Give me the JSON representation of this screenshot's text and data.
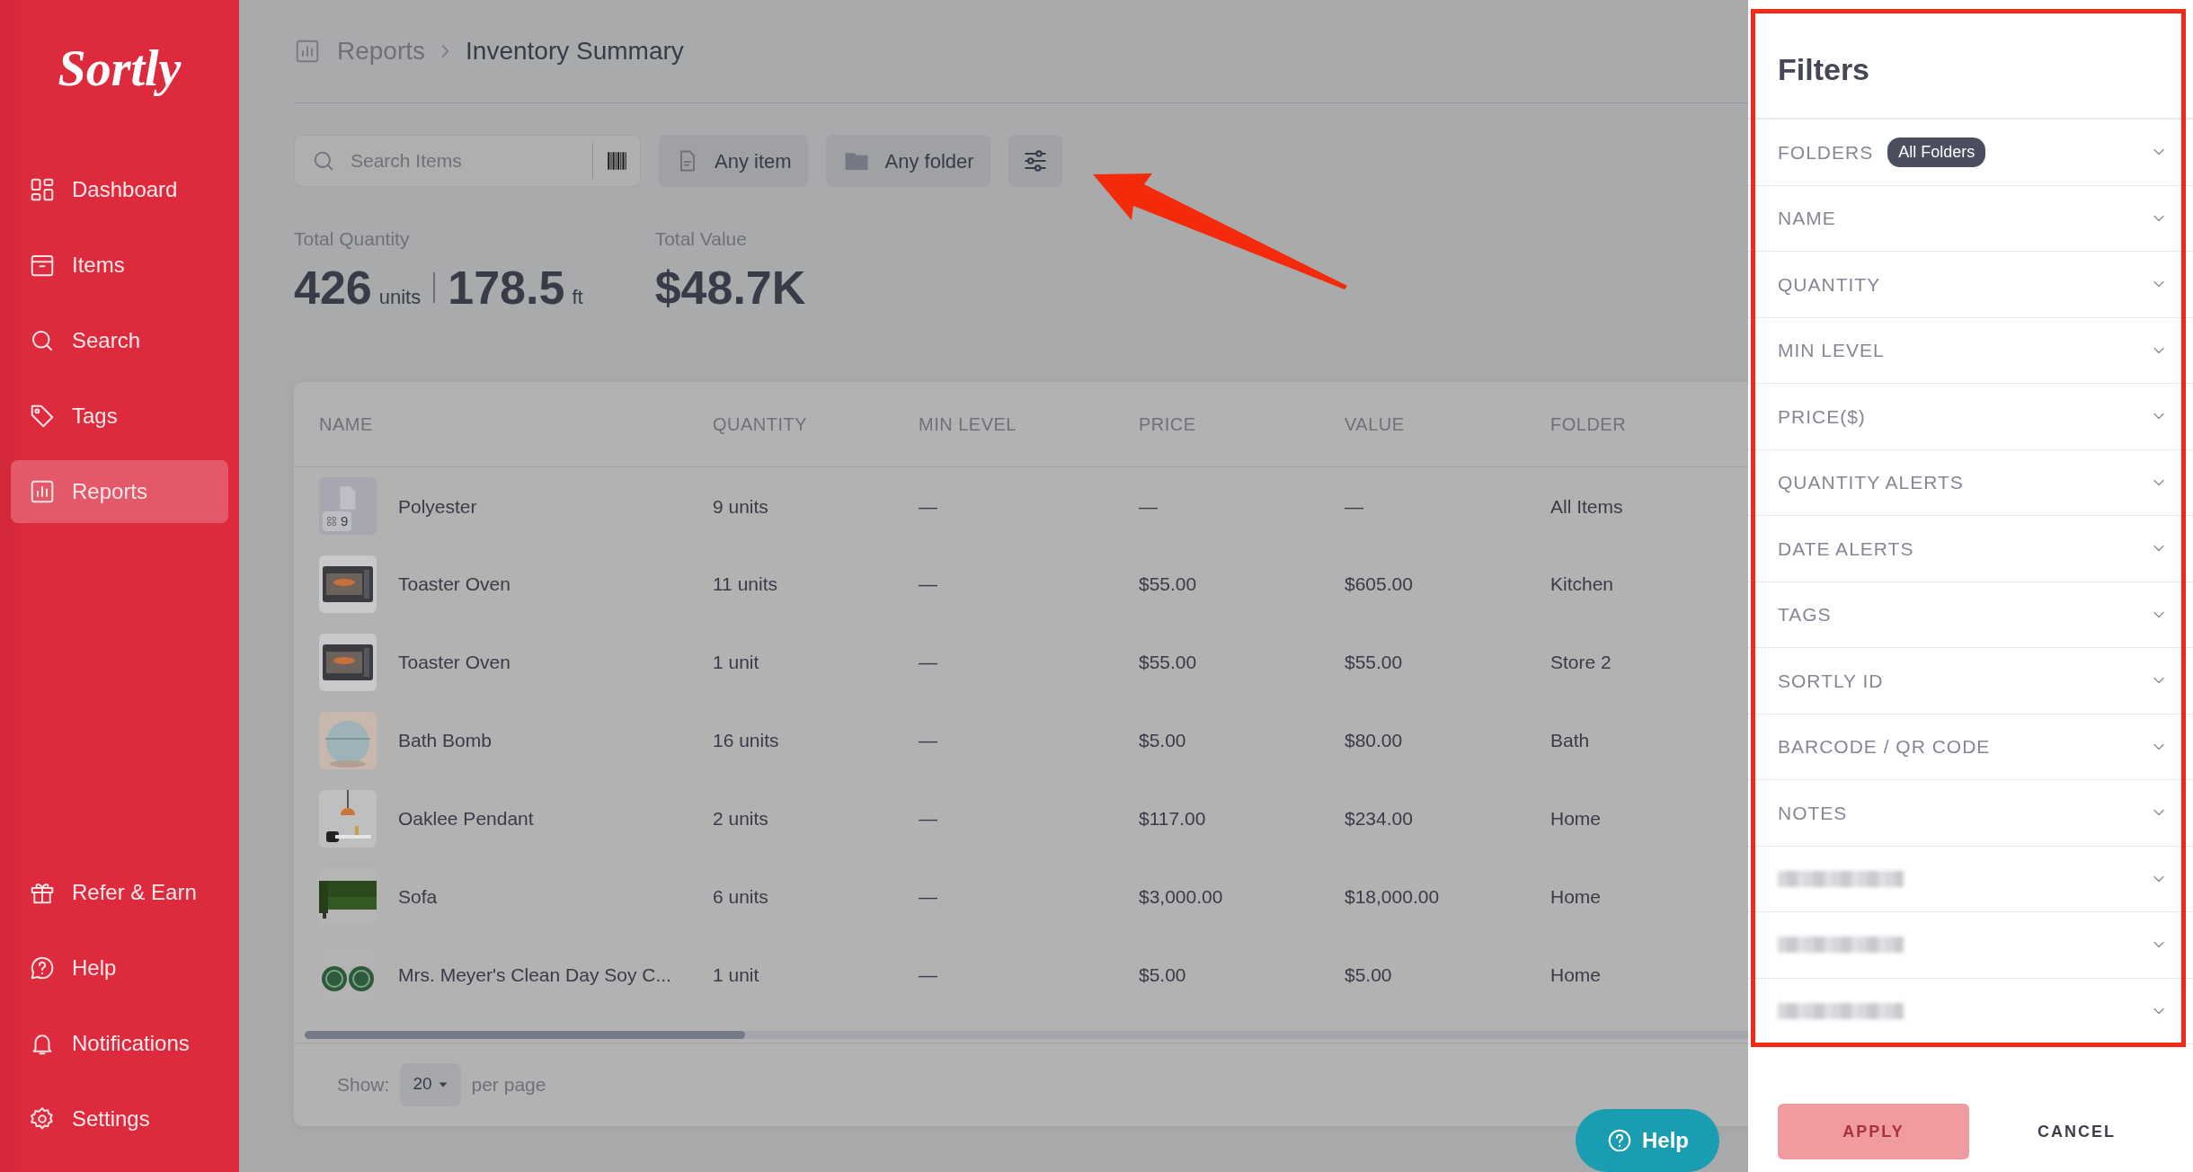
{
  "sidebar": {
    "logo": "Sortly",
    "items": [
      {
        "label": "Dashboard",
        "selected": false
      },
      {
        "label": "Items",
        "selected": false
      },
      {
        "label": "Search",
        "selected": false
      },
      {
        "label": "Tags",
        "selected": false
      },
      {
        "label": "Reports",
        "selected": true
      }
    ],
    "bottom_items": [
      {
        "label": "Refer & Earn",
        "selected": false
      },
      {
        "label": "Help",
        "selected": false
      },
      {
        "label": "Notifications",
        "selected": false
      },
      {
        "label": "Settings",
        "selected": false
      }
    ]
  },
  "breadcrumb": [
    "Reports",
    "Inventory Summary"
  ],
  "toolbar": {
    "search": {
      "placeholder": "Search Items"
    },
    "item_filter": "Any item",
    "folder_filter": "Any folder"
  },
  "totals": {
    "quantity_label": "Total Quantity",
    "quantity": "426",
    "quantity_unit": "units",
    "length": "178.5",
    "length_unit": "ft",
    "value_label": "Total Value",
    "value": "$48.7K"
  },
  "table": {
    "columns": [
      "NAME",
      "QUANTITY",
      "MIN LEVEL",
      "PRICE",
      "VALUE",
      "FOLDER"
    ],
    "rows": [
      {
        "thumbnail": {
          "kind": "placeholder",
          "badge": "9"
        },
        "name": "Polyester",
        "quantity": "9 units",
        "min_level": "—",
        "price": "—",
        "value": "—",
        "folder": "All Items"
      },
      {
        "name": "Toaster Oven",
        "quantity": "11 units",
        "min_level": "—",
        "price": "$55.00",
        "value": "$605.00",
        "folder": "Kitchen"
      },
      {
        "name": "Toaster Oven",
        "quantity": "1 unit",
        "min_level": "—",
        "price": "$55.00",
        "value": "$55.00",
        "folder": "Store 2"
      },
      {
        "name": "Bath Bomb",
        "quantity": "16 units",
        "min_level": "—",
        "price": "$5.00",
        "value": "$80.00",
        "folder": "Bath"
      },
      {
        "name": "Oaklee Pendant",
        "quantity": "2 units",
        "min_level": "—",
        "price": "$117.00",
        "value": "$234.00",
        "folder": "Home"
      },
      {
        "name": "Sofa",
        "quantity": "6 units",
        "min_level": "—",
        "price": "$3,000.00",
        "value": "$18,000.00",
        "folder": "Home"
      },
      {
        "name": "Mrs. Meyer's Clean Day Soy C...",
        "quantity": "1 unit",
        "min_level": "—",
        "price": "$5.00",
        "value": "$5.00",
        "folder": "Home"
      }
    ]
  },
  "pagination": {
    "label": "Show:",
    "page_size": "20",
    "suffix": "per page"
  },
  "help_button": "Help",
  "filters": {
    "title": "Filters",
    "items": [
      {
        "kind": "field",
        "label": "FOLDERS",
        "badge": "All Folders"
      },
      {
        "kind": "field",
        "label": "NAME"
      },
      {
        "kind": "field",
        "label": "QUANTITY"
      },
      {
        "kind": "field",
        "label": "MIN LEVEL"
      },
      {
        "kind": "field",
        "label": "PRICE($)"
      },
      {
        "kind": "field",
        "label": "QUANTITY ALERTS"
      },
      {
        "kind": "field",
        "label": "DATE ALERTS"
      },
      {
        "kind": "field",
        "label": "TAGS"
      },
      {
        "kind": "field",
        "label": "SORTLY ID"
      },
      {
        "kind": "field",
        "label": "BARCODE / QR CODE"
      },
      {
        "kind": "field",
        "label": "NOTES"
      },
      {
        "kind": "redacted"
      },
      {
        "kind": "redacted"
      },
      {
        "kind": "redacted"
      }
    ],
    "apply": {
      "label": "APPLY",
      "disabled": true
    },
    "cancel": "CANCEL"
  }
}
